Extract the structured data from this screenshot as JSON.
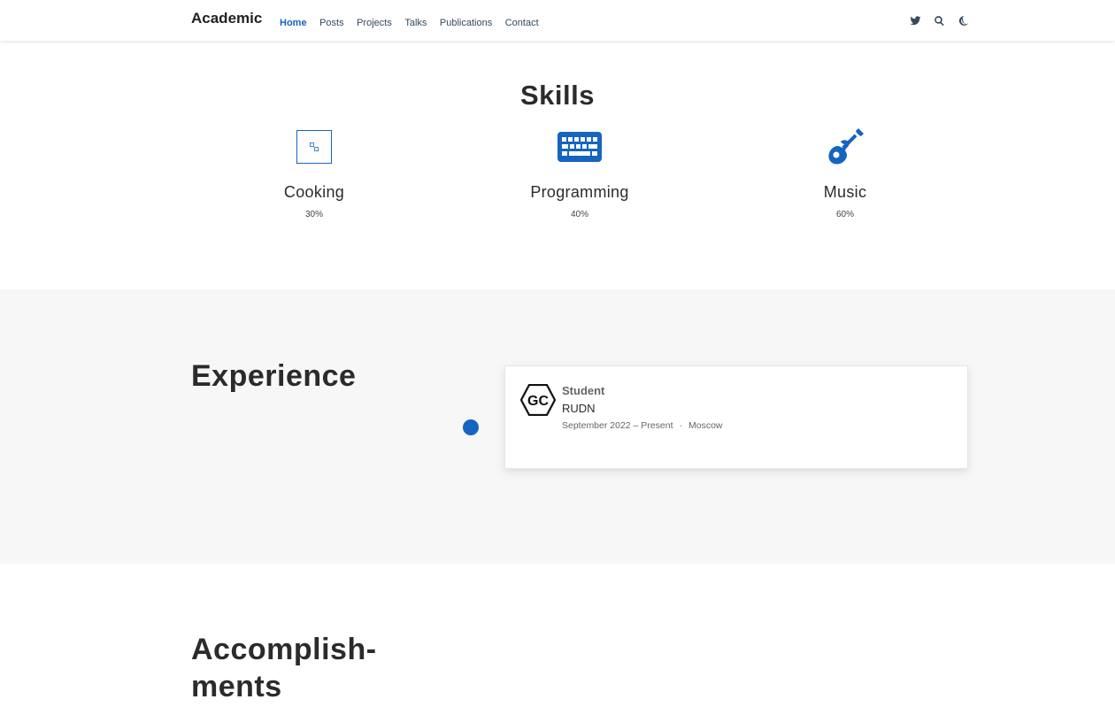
{
  "navbar": {
    "brand": "Academic",
    "links": [
      {
        "label": "Home",
        "active": true
      },
      {
        "label": "Posts",
        "active": false
      },
      {
        "label": "Projects",
        "active": false
      },
      {
        "label": "Talks",
        "active": false
      },
      {
        "label": "Publications",
        "active": false
      },
      {
        "label": "Contact",
        "active": false
      }
    ],
    "icons": [
      "twitter-icon",
      "search-icon",
      "moon-icon"
    ],
    "accent_color": "#1565c0"
  },
  "skills": {
    "title": "Skills",
    "items": [
      {
        "name": "Cooking",
        "percent": "30%",
        "icon": "broken-image-icon"
      },
      {
        "name": "Programming",
        "percent": "40%",
        "icon": "keyboard-icon"
      },
      {
        "name": "Music",
        "percent": "60%",
        "icon": "guitar-icon"
      }
    ]
  },
  "experience": {
    "title": "Experience",
    "items": [
      {
        "role": "Student",
        "organization": "RUDN",
        "dates": "September 2022 – Present",
        "separator": "·",
        "location": "Moscow",
        "logo_text": "GC"
      }
    ]
  },
  "accomplishments": {
    "title_line1": "Accomplish-",
    "title_line2": "ments"
  }
}
